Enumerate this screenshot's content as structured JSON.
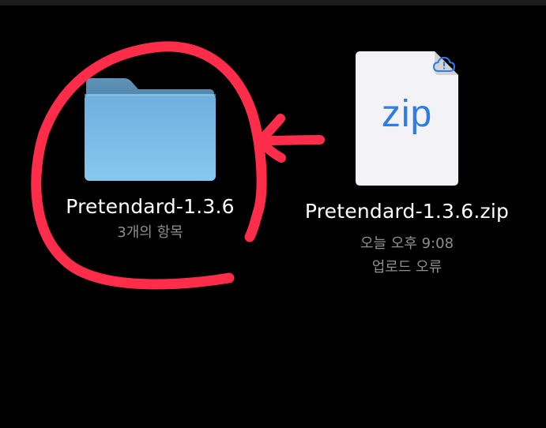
{
  "files": [
    {
      "name": "Pretendard-1.3.6",
      "meta": [
        "3개의 항목"
      ],
      "icon": "folder-icon",
      "color": "#7ec0e6"
    },
    {
      "name": "Pretendard-1.3.6.zip",
      "meta": [
        "오늘 오후 9:08",
        "업로드 오류"
      ],
      "icon": "zip-file-icon",
      "icon_label": "zip",
      "badge": "cloud-alert-icon",
      "color": "#2f7de1"
    }
  ],
  "annotation": {
    "color": "#ff2d4a"
  }
}
